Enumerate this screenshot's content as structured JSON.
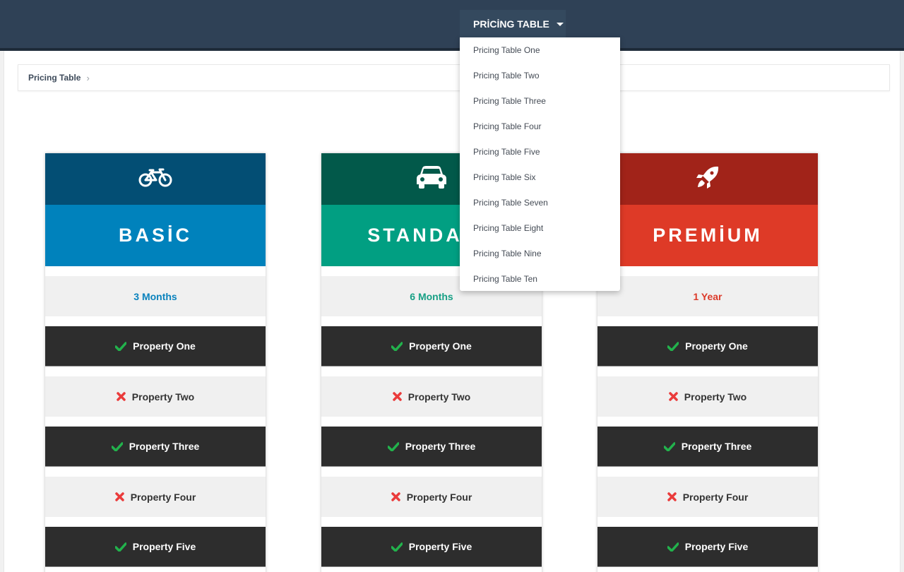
{
  "navbar": {
    "dropdown_label": "PRİCİNG TABLE",
    "menu_items": [
      "Pricing Table One",
      "Pricing Table Two",
      "Pricing Table Three",
      "Pricing Table Four",
      "Pricing Table Five",
      "Pricing Table Six",
      "Pricing Table Seven",
      "Pricing Table Eight",
      "Pricing Table Nine",
      "Pricing Table Ten"
    ]
  },
  "breadcrumb": {
    "current": "Pricing Table",
    "separator": "›"
  },
  "plans": [
    {
      "icon": "bicycle-icon",
      "title": "BASİC",
      "period": "3 Months",
      "colors": {
        "icon_band": "#034e74",
        "title_band": "#0082bc",
        "period_text": "#0a82bd"
      },
      "properties": [
        {
          "label": "Property One",
          "included": true
        },
        {
          "label": "Property Two",
          "included": false
        },
        {
          "label": "Property Three",
          "included": true
        },
        {
          "label": "Property Four",
          "included": false
        },
        {
          "label": "Property Five",
          "included": true
        }
      ]
    },
    {
      "icon": "car-icon",
      "title": "STANDARD",
      "period": "6 Months",
      "colors": {
        "icon_band": "#02594a",
        "title_band": "#019f82",
        "period_text": "#17a085"
      },
      "properties": [
        {
          "label": "Property One",
          "included": true
        },
        {
          "label": "Property Two",
          "included": false
        },
        {
          "label": "Property Three",
          "included": true
        },
        {
          "label": "Property Four",
          "included": false
        },
        {
          "label": "Property Five",
          "included": true
        }
      ]
    },
    {
      "icon": "rocket-icon",
      "title": "PREMİUM",
      "period": "1 Year",
      "colors": {
        "icon_band": "#a12319",
        "title_band": "#de3a27",
        "period_text": "#dc3a2a"
      },
      "properties": [
        {
          "label": "Property One",
          "included": true
        },
        {
          "label": "Property Two",
          "included": false
        },
        {
          "label": "Property Three",
          "included": true
        },
        {
          "label": "Property Four",
          "included": false
        },
        {
          "label": "Property Five",
          "included": true
        }
      ]
    }
  ],
  "status_colors": {
    "check": "#22b24c",
    "cross": "#ea3b3b"
  }
}
